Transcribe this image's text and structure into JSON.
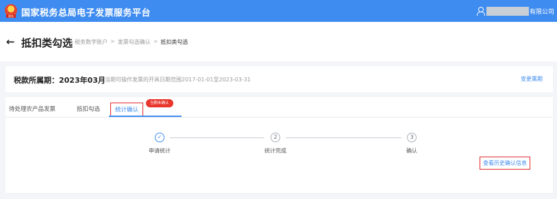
{
  "app": {
    "title": "国家税务总局电子发票服务平台",
    "logo_tag": "税务",
    "user_suffix": "有限公司"
  },
  "header": {
    "back_icon": "arrow-left-icon",
    "title": "抵扣类勾选",
    "breadcrumb": [
      "税务数字账户",
      "发票勾选确认",
      "抵扣类勾选"
    ],
    "breadcrumb_sep": ">"
  },
  "period": {
    "label": "税款所属期：2023年03月",
    "hint": "当期可操作发票的开具日期范围2017-01-01至2023-03-31",
    "change_label": "变更属期"
  },
  "tabs": [
    {
      "label": "待处理农产品发票",
      "active": false
    },
    {
      "label": "抵扣勾选",
      "active": false
    },
    {
      "label": "统计确认",
      "active": true,
      "badge": "当期未确认"
    }
  ],
  "steps": [
    {
      "marker": "✓",
      "label": "申请统计",
      "status": "done"
    },
    {
      "marker": "2",
      "label": "统计完成",
      "status": "pending"
    },
    {
      "marker": "3",
      "label": "确认",
      "status": "pending"
    }
  ],
  "actions": {
    "history_label": "查看历史确认信息"
  },
  "colors": {
    "brand": "#3f8cf0",
    "highlight": "#e0262a",
    "badge": "#e8362c"
  }
}
